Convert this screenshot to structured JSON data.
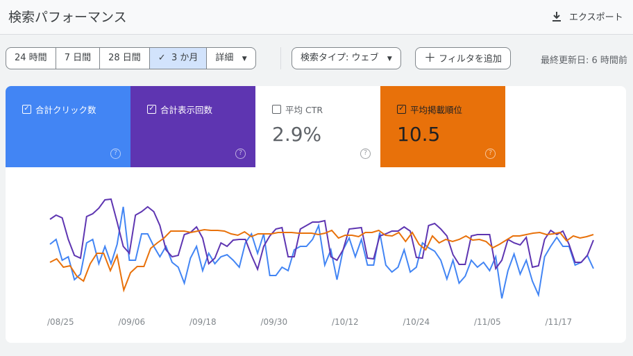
{
  "header": {
    "title": "検索パフォーマンス",
    "export_label": "エクスポート"
  },
  "toolbar": {
    "date_ranges": [
      {
        "label": "24 時間"
      },
      {
        "label": "7 日間"
      },
      {
        "label": "28 日間"
      },
      {
        "label": "3 か月",
        "selected": true
      },
      {
        "label": "詳細"
      }
    ],
    "search_type": "検索タイプ: ウェブ",
    "add_filter": "フィルタを追加",
    "last_updated": "最終更新日: 6 時間前"
  },
  "metrics": [
    {
      "label": "合計クリック数",
      "value": "",
      "checked": true,
      "color": "#4285f4"
    },
    {
      "label": "合計表示回数",
      "value": "",
      "checked": true,
      "color": "#5e35b1"
    },
    {
      "label": "平均 CTR",
      "value": "2.9%",
      "checked": false,
      "color": "#ffffff"
    },
    {
      "label": "平均掲載順位",
      "value": "10.5",
      "checked": true,
      "color": "#e8710a"
    }
  ],
  "chart_data": {
    "type": "line",
    "x_tick_labels": [
      "/08/25",
      "/09/06",
      "/09/18",
      "/09/30",
      "/10/12",
      "/10/24",
      "/11/05",
      "/11/17"
    ],
    "grid": false,
    "series": [
      {
        "metric": "合計クリック数",
        "color": "#4285f4",
        "values": [
          128,
          135,
          105,
          110,
          77,
          85,
          130,
          135,
          100,
          125,
          100,
          128,
          182,
          105,
          105,
          143,
          143,
          125,
          110,
          125,
          102,
          95,
          72,
          108,
          125,
          90,
          115,
          100,
          110,
          113,
          105,
          95,
          130,
          143,
          115,
          143,
          83,
          83,
          95,
          90,
          120,
          125,
          125,
          135,
          155,
          98,
          120,
          77,
          120,
          137,
          110,
          135,
          98,
          98,
          145,
          98,
          88,
          95,
          120,
          88,
          95,
          130,
          123,
          118,
          105,
          78,
          105,
          72,
          82,
          105,
          95,
          102,
          90,
          110,
          50,
          90,
          114,
          85,
          105,
          75,
          55,
          110,
          125,
          138,
          125,
          125,
          98,
          102,
          112,
          93
        ]
      },
      {
        "metric": "合計表示回数",
        "color": "#5e35b1",
        "values": [
          164,
          170,
          166,
          135,
          112,
          108,
          168,
          172,
          180,
          192,
          193,
          160,
          125,
          115,
          170,
          175,
          182,
          175,
          155,
          120,
          110,
          112,
          142,
          145,
          153,
          137,
          100,
          108,
          130,
          125,
          134,
          135,
          135,
          112,
          92,
          125,
          140,
          150,
          152,
          110,
          110,
          150,
          155,
          160,
          160,
          162,
          110,
          105,
          120,
          150,
          151,
          152,
          108,
          107,
          140,
          143,
          147,
          147,
          153,
          147,
          109,
          108,
          155,
          158,
          150,
          140,
          113,
          99,
          99,
          140,
          142,
          142,
          142,
          93,
          105,
          135,
          130,
          127,
          138,
          95,
          97,
          135,
          148,
          142,
          147,
          128,
          102,
          102,
          112,
          134
        ]
      },
      {
        "metric": "平均掲載順位",
        "color": "#e8710a",
        "values": [
          102,
          107,
          95,
          97,
          82,
          75,
          100,
          115,
          115,
          90,
          112,
          62,
          87,
          96,
          96,
          122,
          130,
          137,
          147,
          147,
          147,
          145,
          147,
          149,
          148,
          148,
          147,
          143,
          141,
          146,
          139,
          143,
          143,
          143,
          145,
          145,
          145,
          144,
          144,
          144,
          142,
          144,
          148,
          137,
          141,
          141,
          139,
          145,
          145,
          148,
          141,
          140,
          145,
          132,
          145,
          128,
          120,
          140,
          130,
          135,
          132,
          135,
          140,
          134,
          135,
          132,
          123,
          128,
          134,
          140,
          140,
          142,
          144,
          145,
          142,
          143,
          145,
          133,
          140,
          137,
          139,
          142
        ]
      }
    ]
  }
}
